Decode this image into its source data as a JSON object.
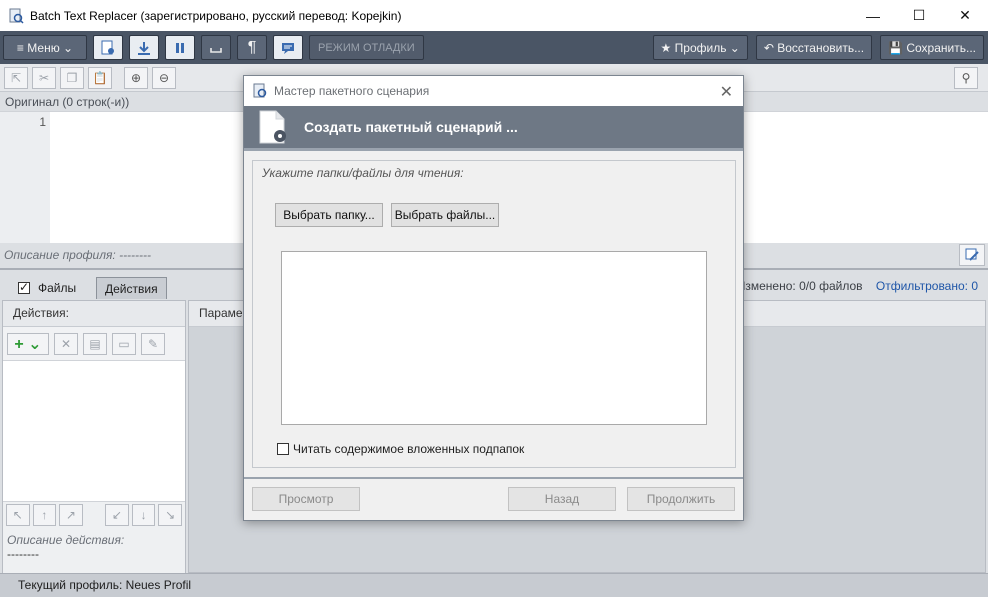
{
  "window": {
    "title": "Batch Text Replacer (зарегистрировано,  русский перевод: Kopejkin)",
    "minimize": "—",
    "maximize": "☐",
    "close": "✕"
  },
  "toolbar": {
    "menu_label": "≡ Меню ⌄",
    "debug_label": "РЕЖИМ ОТЛАДКИ",
    "profile_label": "★ Профиль ⌄",
    "restore_label": "↶ Восстановить...",
    "save_label": "💾 Сохранить..."
  },
  "editor": {
    "original_label": "Оригинал (0 строк(-и))",
    "line_number": "1",
    "profile_description": "Описание профиля:  --------"
  },
  "tabs": {
    "files": "Файлы",
    "actions": "Действия"
  },
  "files_stats": {
    "changed": "Изменено: 0/0 файлов",
    "filtered": "Отфильтровано: 0"
  },
  "actions_panel": {
    "header": "Действия:",
    "description_label": "Описание действия:",
    "description_value": "--------"
  },
  "params_panel": {
    "header": "Параме"
  },
  "status": {
    "current_profile": "Текущий профиль: Neues Profil"
  },
  "dialog": {
    "title": "Мастер пакетного сценария",
    "close": "✕",
    "header": "Создать пакетный сценарий ...",
    "prompt": "Укажите папки/файлы для чтения:",
    "choose_folder": "Выбрать папку...",
    "choose_files": "Выбрать файлы...",
    "subfolders": "Читать содержимое вложенных подпапок",
    "preview": "Просмотр",
    "back": "Назад",
    "continue": "Продолжить"
  },
  "colors": {
    "toolbar_bg": "#4a5565",
    "dialog_header_bg": "#6e7885",
    "filtered_link": "#1f56a8"
  }
}
